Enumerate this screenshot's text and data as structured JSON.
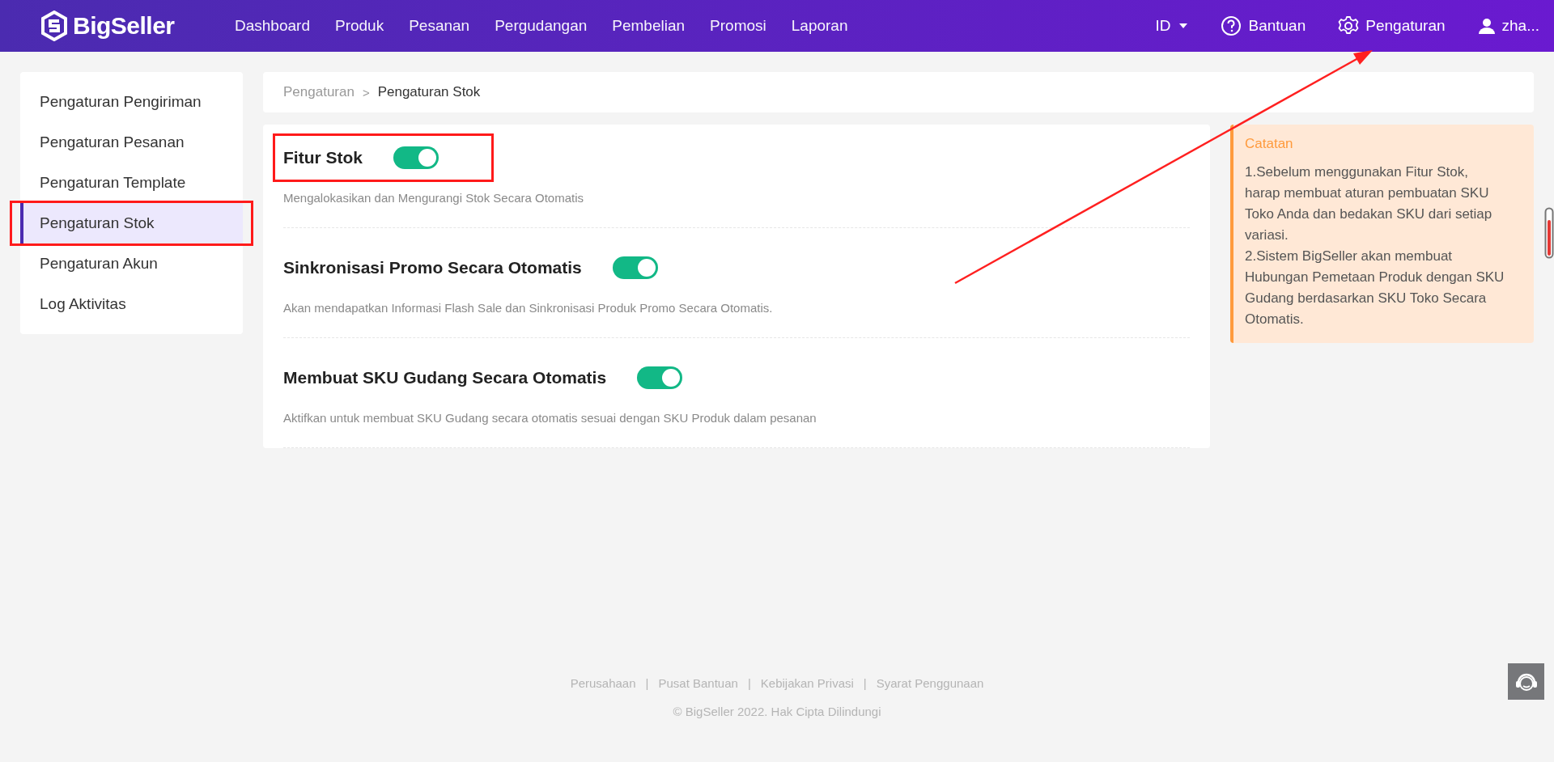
{
  "header": {
    "logo": "BigSeller",
    "nav": [
      {
        "label": "Dashboard",
        "selected": false
      },
      {
        "label": "Produk",
        "selected": false
      },
      {
        "label": "Pesanan",
        "selected": false
      },
      {
        "label": "Pergudangan",
        "selected": false
      },
      {
        "label": "Pembelian",
        "selected": false
      },
      {
        "label": "Promosi",
        "selected": false
      },
      {
        "label": "Laporan",
        "selected": false
      }
    ],
    "language": "ID",
    "help": "Bantuan",
    "settings": "Pengaturan",
    "user": "zha..."
  },
  "sidebar": {
    "items": [
      {
        "label": "Pengaturan Pengiriman",
        "selected": false,
        "highlighted": false
      },
      {
        "label": "Pengaturan Pesanan",
        "selected": false,
        "highlighted": false
      },
      {
        "label": "Pengaturan Template",
        "selected": false,
        "highlighted": false
      },
      {
        "label": "Pengaturan Stok",
        "selected": true,
        "highlighted": true
      },
      {
        "label": "Pengaturan Akun",
        "selected": false,
        "highlighted": false
      },
      {
        "label": "Log Aktivitas",
        "selected": false,
        "highlighted": false
      }
    ]
  },
  "breadcrumb": [
    "Pengaturan",
    "Pengaturan Stok"
  ],
  "breadcrumb_separator": ">",
  "settings": [
    {
      "title": "Fitur Stok",
      "on": true,
      "highlighted": true,
      "description": "Mengalokasikan dan Mengurangi Stok Secara Otomatis"
    },
    {
      "title": "Sinkronisasi Promo Secara Otomatis",
      "on": true,
      "highlighted": false,
      "description": "Akan mendapatkan Informasi Flash Sale dan Sinkronisasi Produk Promo Secara Otomatis."
    },
    {
      "title": "Membuat SKU Gudang Secara Otomatis",
      "on": true,
      "highlighted": false,
      "description": "Aktifkan untuk membuat SKU Gudang secara otomatis sesuai dengan SKU Produk dalam pesanan"
    }
  ],
  "note": {
    "title": "Catatan",
    "lines": [
      "1.Sebelum menggunakan Fitur Stok, harap membuat aturan pembuatan SKU Toko Anda dan bedakan SKU dari setiap variasi.",
      "2.Sistem BigSeller akan membuat Hubungan Pemetaan Produk dengan SKU Gudang berdasarkan SKU Toko Secara Otomatis."
    ]
  },
  "footer": {
    "separator": "|",
    "links": [
      "Perusahaan",
      "Pusat Bantuan",
      "Kebijakan Privasi",
      "Syarat Penggunaan"
    ],
    "copyright": "© BigSeller 2022. Hak Cipta Dilindungi"
  }
}
